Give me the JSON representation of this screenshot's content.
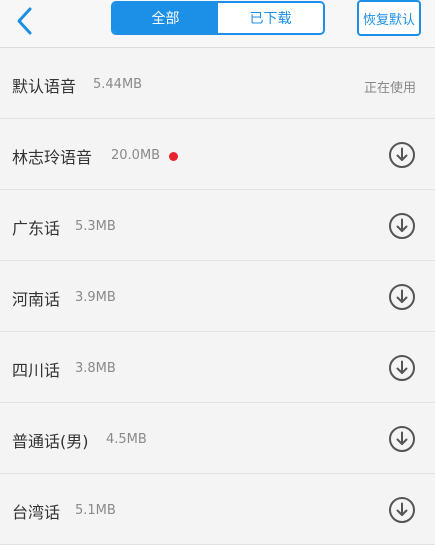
{
  "header": {
    "tabs": [
      {
        "label": "全部",
        "active": true
      },
      {
        "label": "已下载",
        "active": false
      }
    ],
    "restore_label": "恢复默认"
  },
  "colors": {
    "accent": "#1c8fe6",
    "background": "#f4f4f4",
    "new_dot": "#e8232d"
  },
  "voices": [
    {
      "name": "默认语音",
      "size": "5.44MB",
      "status": "正在使用"
    },
    {
      "name": "林志玲语音",
      "size": "20.0MB",
      "new": true,
      "action_icon": "download-icon"
    },
    {
      "name": "广东话",
      "size": "5.3MB",
      "action_icon": "download-icon"
    },
    {
      "name": "河南话",
      "size": "3.9MB",
      "action_icon": "download-icon"
    },
    {
      "name": "四川话",
      "size": "3.8MB",
      "action_icon": "download-icon"
    },
    {
      "name": "普通话(男)",
      "size": "4.5MB",
      "action_icon": "download-icon"
    },
    {
      "name": "台湾话",
      "size": "5.1MB",
      "action_icon": "download-icon"
    }
  ]
}
